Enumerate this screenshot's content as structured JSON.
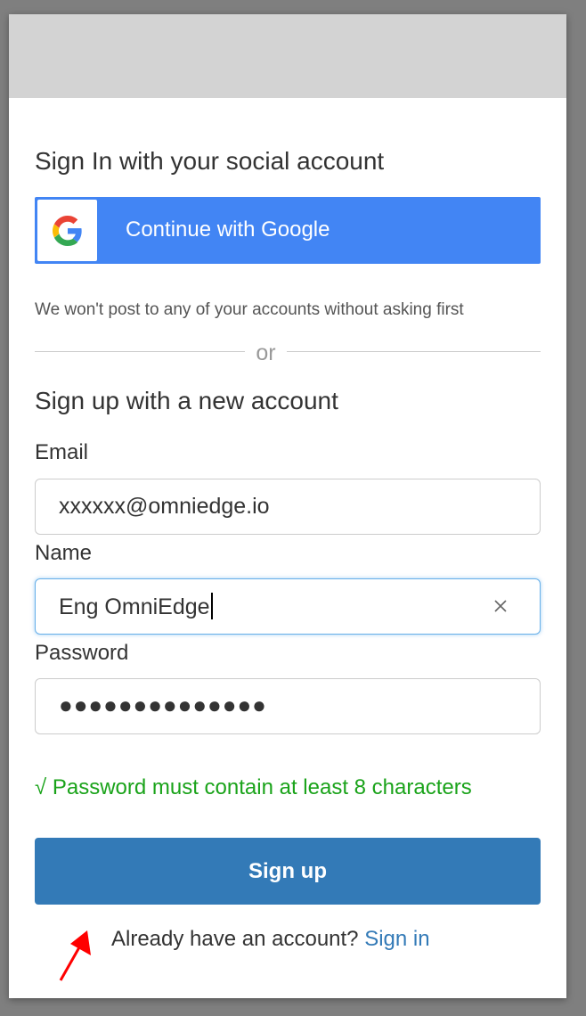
{
  "social": {
    "heading": "Sign In with your social account",
    "google_button_label": "Continue with Google",
    "google_icon": "google-g-icon",
    "notice": "We won't post to any of your accounts without asking first"
  },
  "divider": {
    "text": "or"
  },
  "signup": {
    "heading": "Sign up with a new account",
    "email": {
      "label": "Email",
      "value": "xxxxxx@omniedge.io"
    },
    "name": {
      "label": "Name",
      "value": "Eng OmniEdge"
    },
    "password": {
      "label": "Password",
      "masked_value": "●●●●●●●●●●●●●●"
    },
    "password_rule": "√ Password must contain at least 8 characters",
    "submit_label": "Sign up"
  },
  "footer": {
    "prompt": "Already have an account?",
    "link_label": "Sign in"
  },
  "colors": {
    "google_blue": "#4285f4",
    "primary": "#337ab7",
    "success": "#1aa31a",
    "header_gray": "#d3d3d3",
    "annotation_red": "#ff0000"
  }
}
